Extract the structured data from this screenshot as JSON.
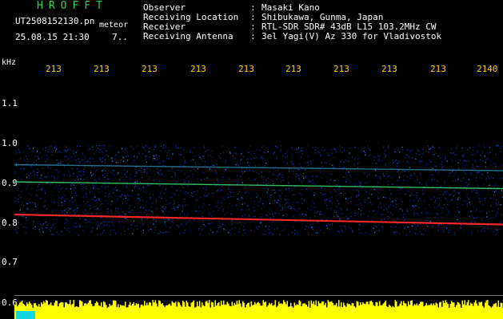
{
  "header": {
    "logo": "HROFFT",
    "filename": "UT2508152130.pn",
    "tag": "meteor",
    "datetime": "25.08.15 21:30",
    "count": "7..",
    "fields": [
      {
        "label": "Observer",
        "sep": ":",
        "value": "Masaki Kano"
      },
      {
        "label": "Receiving Location",
        "sep": ":",
        "value": "Shibukawa, Gunma, Japan"
      },
      {
        "label": "Receiver",
        "sep": ":",
        "value": "RTL-SDR SDR# 43dB L15 103.2MHz CW"
      },
      {
        "label": "Receiving Antenna",
        "sep": ":",
        "value": "3el Yagi(V) Az 330 for Vladivostok"
      }
    ]
  },
  "axis": {
    "y_unit": "kHz",
    "y_ticks": [
      "1.1",
      "1.0",
      "0.9",
      "0.8",
      "0.7",
      "0.6"
    ],
    "x_ticks": [
      "213",
      "213",
      "213",
      "213",
      "213",
      "213",
      "213",
      "213",
      "213",
      "2140"
    ]
  },
  "colors": {
    "background": "#000000",
    "time_ticks": "#ffd400",
    "logo": "#2ad84a",
    "noise": "#1e3fc8",
    "echo_mid": "#33cc66",
    "echo_strong": "#ff2a2a",
    "level_bar": "#ffff00"
  },
  "chart_data": {
    "type": "heatmap",
    "ylabel": "kHz",
    "ylim": [
      0.6,
      1.15
    ],
    "traces": [
      {
        "start_khz": 0.83,
        "end_khz": 0.805,
        "intensity": "strong"
      },
      {
        "start_khz": 0.912,
        "end_khz": 0.895,
        "intensity": "medium"
      },
      {
        "start_khz": 0.955,
        "end_khz": 0.94,
        "intensity": "weak"
      }
    ]
  }
}
